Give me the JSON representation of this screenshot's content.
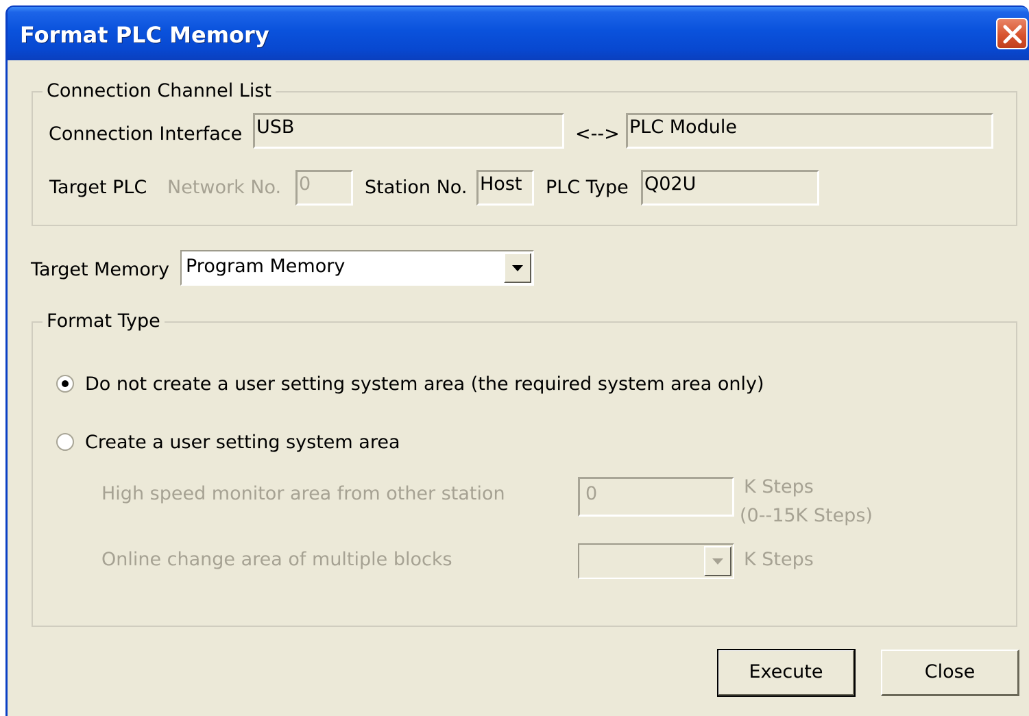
{
  "window": {
    "title": "Format PLC Memory"
  },
  "connection": {
    "group_label": "Connection Channel List",
    "interface_label": "Connection Interface",
    "interface_value": "USB",
    "arrow": "<-->",
    "module_value": "PLC Module",
    "target_plc_label": "Target PLC",
    "network_label": "Network No.",
    "network_value": "0",
    "station_label": "Station No.",
    "station_value": "Host",
    "plc_type_label": "PLC Type",
    "plc_type_value": "Q02U"
  },
  "target_memory": {
    "label": "Target Memory",
    "selected": "Program Memory"
  },
  "format_type": {
    "group_label": "Format Type",
    "option1": "Do not create a user setting system area (the required system area only)",
    "option2": "Create a user setting system area",
    "selected_option": 1,
    "hs_label": "High speed monitor area from other station",
    "hs_value": "0",
    "hs_unit": "K Steps",
    "hs_range": "(0--15K Steps)",
    "oc_label": "Online change area of multiple blocks",
    "oc_value": "",
    "oc_unit": "K Steps"
  },
  "buttons": {
    "execute": "Execute",
    "close": "Close"
  },
  "colors": {
    "title_bar": "#0a52dc",
    "dialog_bg": "#ece9d8",
    "disabled_text": "#a6a293",
    "close_button": "#d8542e"
  }
}
